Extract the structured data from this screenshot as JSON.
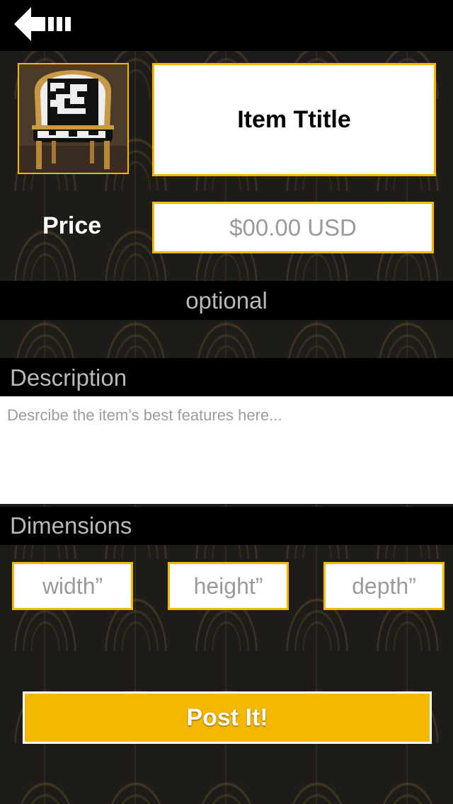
{
  "header": {
    "back_icon": "back-arrow-icon"
  },
  "item": {
    "photo": "chair-photo",
    "title": "Item Ttitle"
  },
  "price": {
    "label": "Price",
    "placeholder": "$00.00 USD"
  },
  "optional": {
    "label": "optional"
  },
  "description": {
    "label": "Description",
    "placeholder": "Desrcibe the item’s best features here..."
  },
  "dimensions": {
    "label": "Dimensions",
    "width_placeholder": "width”",
    "height_placeholder": "height”",
    "depth_placeholder": "depth”"
  },
  "actions": {
    "post_label": "Post It!"
  },
  "colors": {
    "accent": "#f5b800",
    "bar": "#000000",
    "background": "#1e1c19"
  }
}
